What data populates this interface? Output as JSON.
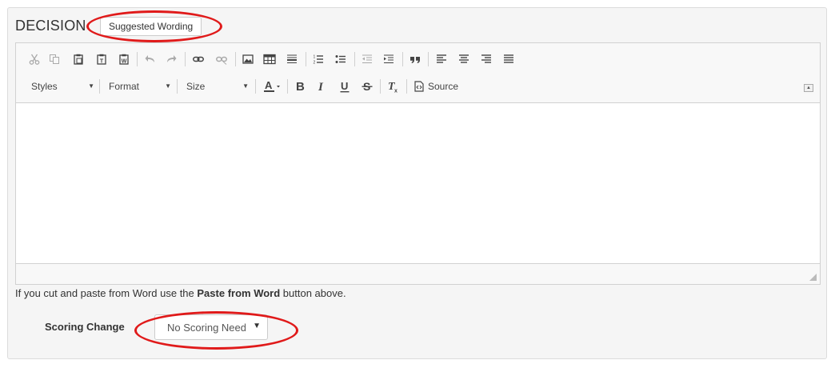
{
  "section": {
    "title": "DECISION",
    "suggested_button": "Suggested Wording"
  },
  "editor": {
    "toolbar": {
      "styles_label": "Styles",
      "format_label": "Format",
      "size_label": "Size",
      "source_label": "Source",
      "icons": [
        "cut-icon",
        "copy-icon",
        "paste-icon",
        "paste-text-icon",
        "paste-from-word-icon",
        "undo-icon",
        "redo-icon",
        "link-icon",
        "unlink-icon",
        "image-icon",
        "table-icon",
        "horizontal-line-icon",
        "numbered-list-icon",
        "bulleted-list-icon",
        "decrease-indent-icon",
        "increase-indent-icon",
        "blockquote-icon",
        "align-left-icon",
        "align-center-icon",
        "align-right-icon",
        "justify-icon",
        "text-color-icon",
        "bold-icon",
        "italic-icon",
        "underline-icon",
        "strikethrough-icon",
        "remove-format-icon",
        "source-icon"
      ]
    },
    "content": ""
  },
  "hint": {
    "prefix": "If you cut and paste from Word use the ",
    "bold": "Paste from Word",
    "suffix": " button above."
  },
  "scoring": {
    "label": "Scoring Change",
    "selected": "No Scoring Needed"
  },
  "colors": {
    "highlight": "#e01a1a",
    "panel_bg": "#f5f5f5",
    "toolbar_bg": "#f8f8f8"
  }
}
